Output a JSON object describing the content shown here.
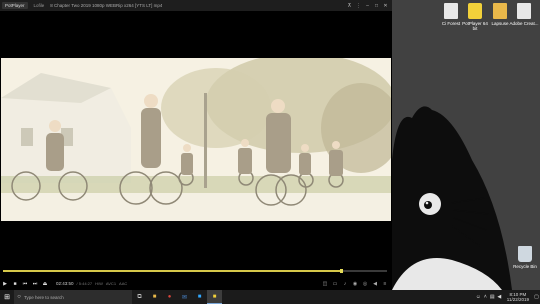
{
  "player": {
    "app_name": "PotPlayer",
    "tab_label": "Lofile",
    "file_title": "8 Chapter Two 2019 1080p WEBRip x264 [YTS LT] mp4",
    "time_display": "02:43:50",
    "duration_display": "/ 5:44:27",
    "codec_tags": [
      "H/W",
      "AVC1",
      "AAC"
    ],
    "progress_fraction": 0.88
  },
  "desktop_icons": [
    {
      "label": "Ci Forest",
      "color": "#e8e8e8"
    },
    {
      "label": "PotPlayer 64 bit",
      "color": "#f2d13a"
    },
    {
      "label": "Lapsuse",
      "color": "#e9b84a"
    },
    {
      "label": "Adobe Creat...",
      "color": "#e8e8e8"
    },
    {
      "label": "Recycle Bin",
      "color": "#cfd8e0"
    }
  ],
  "taskbar": {
    "search_placeholder": "Type here to search",
    "apps": [
      "folder-icon",
      "chrome-icon",
      "mail-icon",
      "photoshop-icon",
      "potplayer-icon"
    ],
    "clock_time": "8:10 PM",
    "clock_date": "11/22/2019"
  },
  "colors": {
    "accent": "#d6c84a",
    "desktop_bg": "#414141",
    "taskbar_bg": "#1b1b1b"
  }
}
